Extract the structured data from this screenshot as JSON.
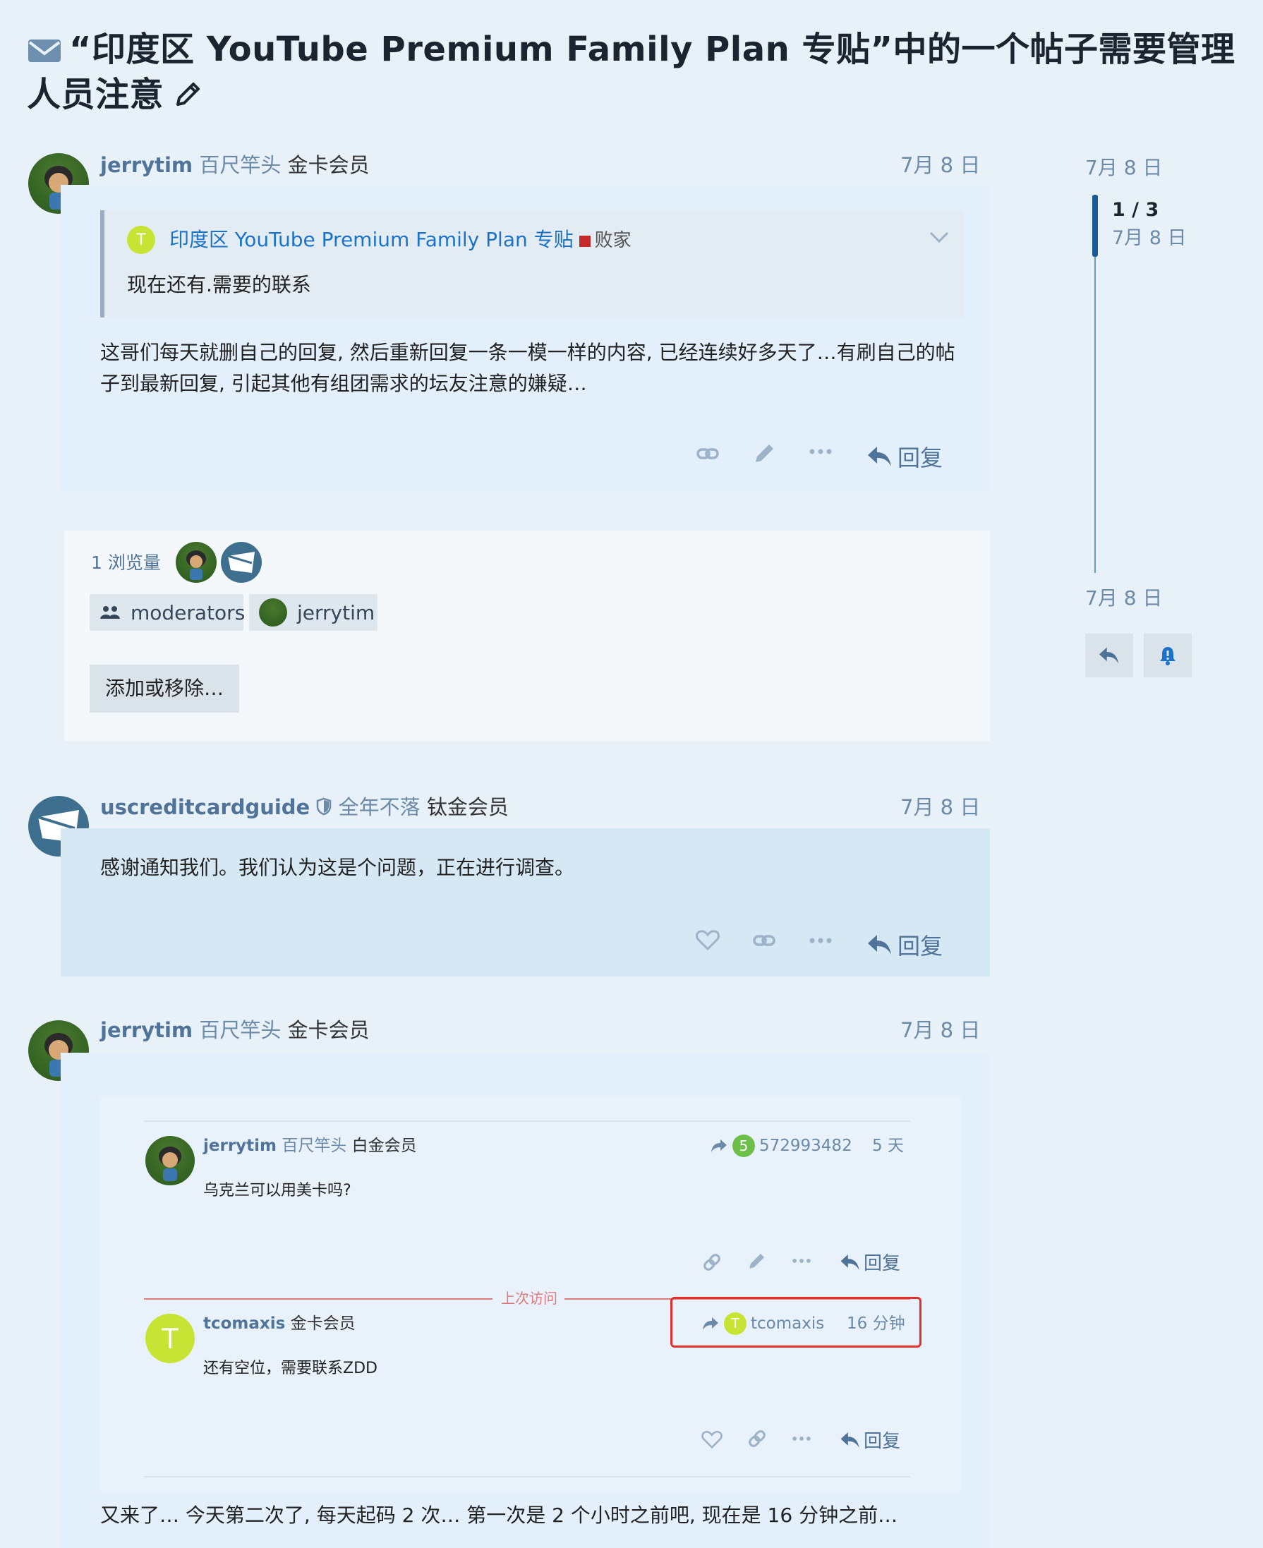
{
  "topic": {
    "title": "“印度区 YouTube Premium Family Plan 专贴”中的一个帖子需要管理人员注意"
  },
  "posts": [
    {
      "username": "jerrytim",
      "user_title": "百尺竿头",
      "user_group": "金卡会员",
      "date": "7月 8 日",
      "quote": {
        "avatar_letter": "T",
        "link_text": "印度区 YouTube Premium Family Plan 专贴",
        "category": "败家",
        "text": "现在还有.需要的联系"
      },
      "body": "这哥们每天就删自己的回复, 然后重新回复一条一模一样的内容, 已经连续好多天了…有刷自己的帖子到最新回复, 引起其他有组团需求的坛友注意的嫌疑…",
      "reply_label": "回复"
    },
    {
      "username": "uscreditcardguide",
      "user_title": "全年不落",
      "user_group": "钛金会员",
      "date": "7月 8 日",
      "body": "感谢通知我们。我们认为这是个问题，正在进行调查。",
      "reply_label": "回复"
    },
    {
      "username": "jerrytim",
      "user_title": "百尺竿头",
      "user_group": "金卡会员",
      "date": "7月 8 日",
      "body": "又来了… 今天第二次了, 每天起码 2 次… 第一次是 2 个小时之前吧, 现在是 16 分钟之前…"
    }
  ],
  "participants": {
    "views": "1 浏览量",
    "chips": [
      "moderators",
      "jerrytim"
    ],
    "add_remove": "添加或移除…"
  },
  "embedded": [
    {
      "username": "jerrytim",
      "user_title": "百尺竿头",
      "user_group": "白金会员",
      "reply_to_badge": "5",
      "reply_to": "572993482",
      "age": "5 天",
      "body": "乌克兰可以用美卡吗?",
      "reply_label": "回复"
    },
    {
      "username": "tcomaxis",
      "user_group": "金卡会员",
      "avatar_letter": "T",
      "reply_to_letter": "T",
      "reply_to": "tcomaxis",
      "age": "16 分钟",
      "body": "还有空位，需要联系ZDD",
      "reply_label": "回复"
    }
  ],
  "last_visit_label": "上次访问",
  "timeline": {
    "start_date": "7月 8 日",
    "position": "1 / 3",
    "position_date": "7月 8 日",
    "end_date": "7月 8 日"
  }
}
